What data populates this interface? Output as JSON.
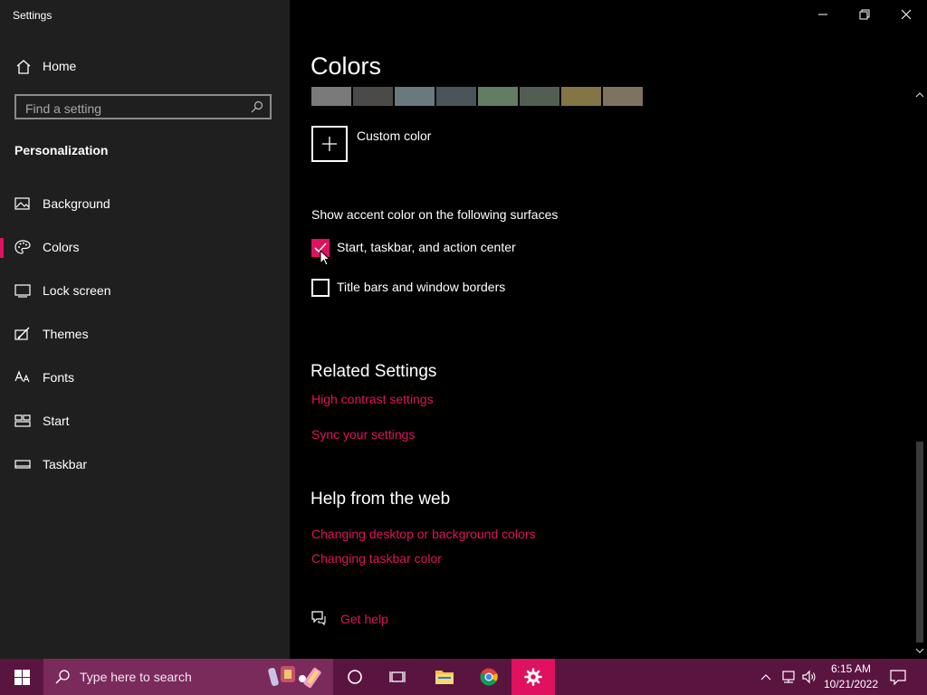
{
  "window": {
    "title": "Settings"
  },
  "sidebar": {
    "home_label": "Home",
    "search_placeholder": "Find a setting",
    "section_title": "Personalization",
    "items": [
      {
        "label": "Background",
        "icon": "picture-icon",
        "selected": false
      },
      {
        "label": "Colors",
        "icon": "palette-icon",
        "selected": true
      },
      {
        "label": "Lock screen",
        "icon": "lock-screen-icon",
        "selected": false
      },
      {
        "label": "Themes",
        "icon": "brush-icon",
        "selected": false
      },
      {
        "label": "Fonts",
        "icon": "fonts-icon",
        "selected": false
      },
      {
        "label": "Start",
        "icon": "start-icon",
        "selected": false
      },
      {
        "label": "Taskbar",
        "icon": "taskbar-icon",
        "selected": false
      }
    ]
  },
  "main": {
    "title": "Colors",
    "swatches": [
      "#7a7a7a",
      "#4c4a48",
      "#69797e",
      "#4a5459",
      "#647c64",
      "#525e54",
      "#847545",
      "#7e735f"
    ],
    "custom_color_label": "Custom color",
    "accent_heading": "Show accent color on the following surfaces",
    "checkboxes": [
      {
        "label": "Start, taskbar, and action center",
        "checked": true
      },
      {
        "label": "Title bars and window borders",
        "checked": false
      }
    ],
    "related_heading": "Related Settings",
    "related_links": [
      "High contrast settings",
      "Sync your settings"
    ],
    "help_heading": "Help from the web",
    "help_links": [
      "Changing desktop or background colors",
      "Changing taskbar color"
    ],
    "get_help_label": "Get help"
  },
  "taskbar": {
    "search_placeholder": "Type here to search",
    "time": "6:15 AM",
    "date": "10/21/2022",
    "accent_color": "#e0115f"
  }
}
